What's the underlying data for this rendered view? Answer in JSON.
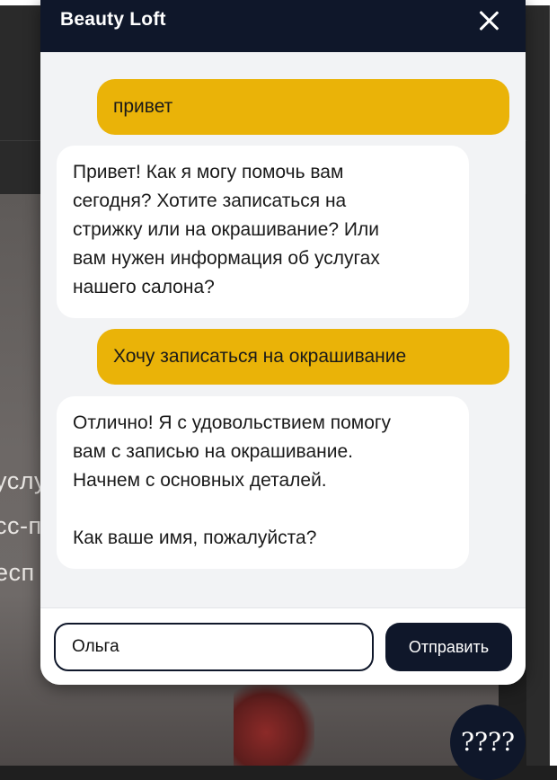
{
  "background": {
    "text_lines": [
      "услу",
      "сс-п",
      "есп"
    ]
  },
  "chat": {
    "title": "Beauty Loft",
    "messages": [
      {
        "role": "user",
        "text": "привет"
      },
      {
        "role": "bot",
        "text": "Привет! Как я могу помочь вам\nсегодня? Хотите записаться на\nстрижку или на окрашивание? Или\nвам нужен информация об услугах\nнашего салона?"
      },
      {
        "role": "user",
        "text": "Хочу записаться на окрашивание"
      },
      {
        "role": "bot",
        "text": "Отлично! Я с удовольствием помогу\nвам с записью на окрашивание.\nНачнем с основных деталей.\n\nКак ваше имя, пожалуйста?"
      }
    ],
    "input": {
      "value": "Ольга",
      "placeholder": ""
    },
    "send_label": "Отправить"
  },
  "launcher": {
    "label": "????"
  },
  "colors": {
    "header": "#0f172a",
    "user_bubble": "#eab308",
    "bot_bubble": "#ffffff",
    "panel": "#f2f3f5"
  }
}
